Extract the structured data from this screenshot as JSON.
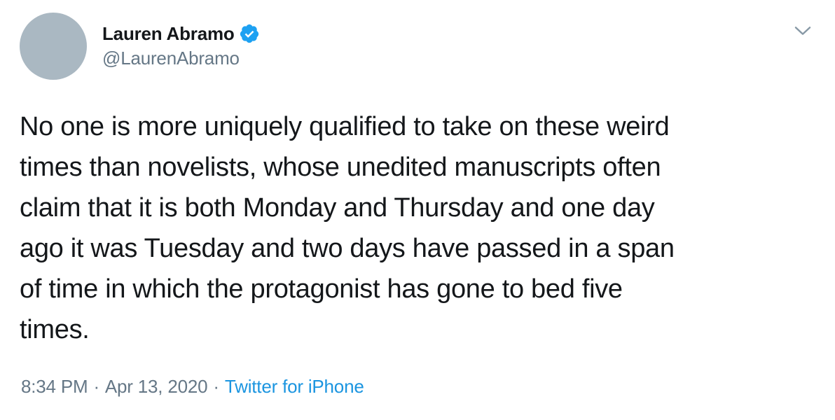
{
  "author": {
    "display_name": "Lauren Abramo",
    "handle": "@LaurenAbramo",
    "verified": true
  },
  "tweet": {
    "text": "No one is more uniquely qualified to take on these weird\ntimes than novelists, whose unedited manuscripts often\nclaim that it is both Monday and Thursday and one day\nago it was Tuesday and two days have passed in a span\nof time in which the protagonist has gone to bed five\ntimes."
  },
  "meta": {
    "time": "8:34 PM",
    "separator1": "·",
    "date": "Apr 13, 2020",
    "separator2": "·",
    "source": "Twitter for iPhone"
  },
  "colors": {
    "accent": "#1da1f2",
    "source_link": "#1b95e0",
    "secondary_text": "#657786",
    "primary_text": "#14171a",
    "avatar_placeholder": "#aab8c2"
  },
  "icons": {
    "verified": "verified-badge-icon",
    "caret": "chevron-down-icon"
  }
}
